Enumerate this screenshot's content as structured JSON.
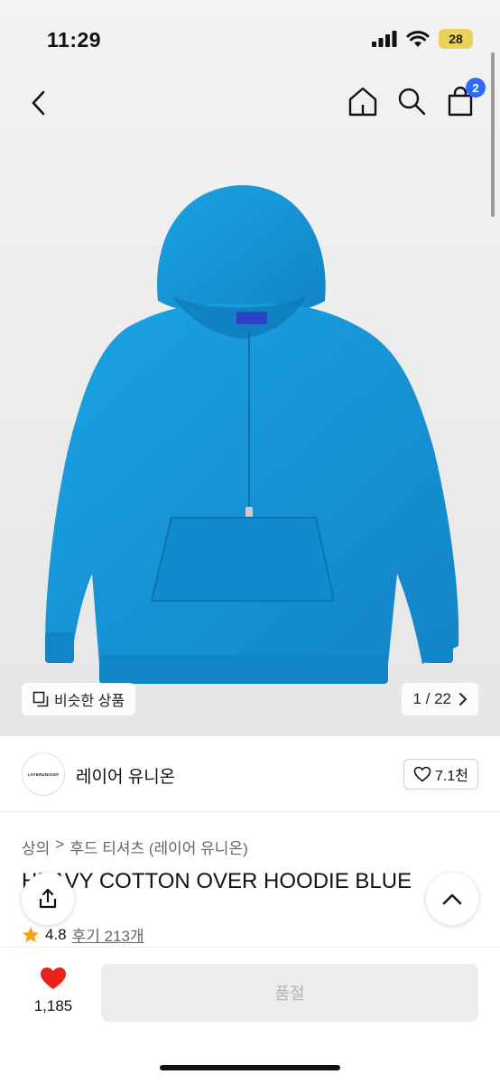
{
  "status_bar": {
    "time": "11:29",
    "battery": "28"
  },
  "nav": {
    "cart_count": "2"
  },
  "gallery": {
    "similar_label": "비슷한 상품",
    "page_indicator": "1 / 22"
  },
  "brand": {
    "logo_text": "LAYERUNION®",
    "name": "레이어 유니온",
    "likes": "7.1천"
  },
  "breadcrumb": [
    "상의",
    ">",
    "후드 티셔츠 (레이어 유니온)"
  ],
  "product": {
    "title": "HEAVY COTTON OVER HOODIE BLUE",
    "rating": "4.8",
    "reviews": "후기 213개"
  },
  "bottom": {
    "wish_count": "1,185",
    "buy_label": "품절"
  },
  "colors": {
    "hoodie": "#1596d8",
    "accent_badge": "#2f6cf6",
    "heart": "#e8231f",
    "star": "#f2a51a"
  }
}
